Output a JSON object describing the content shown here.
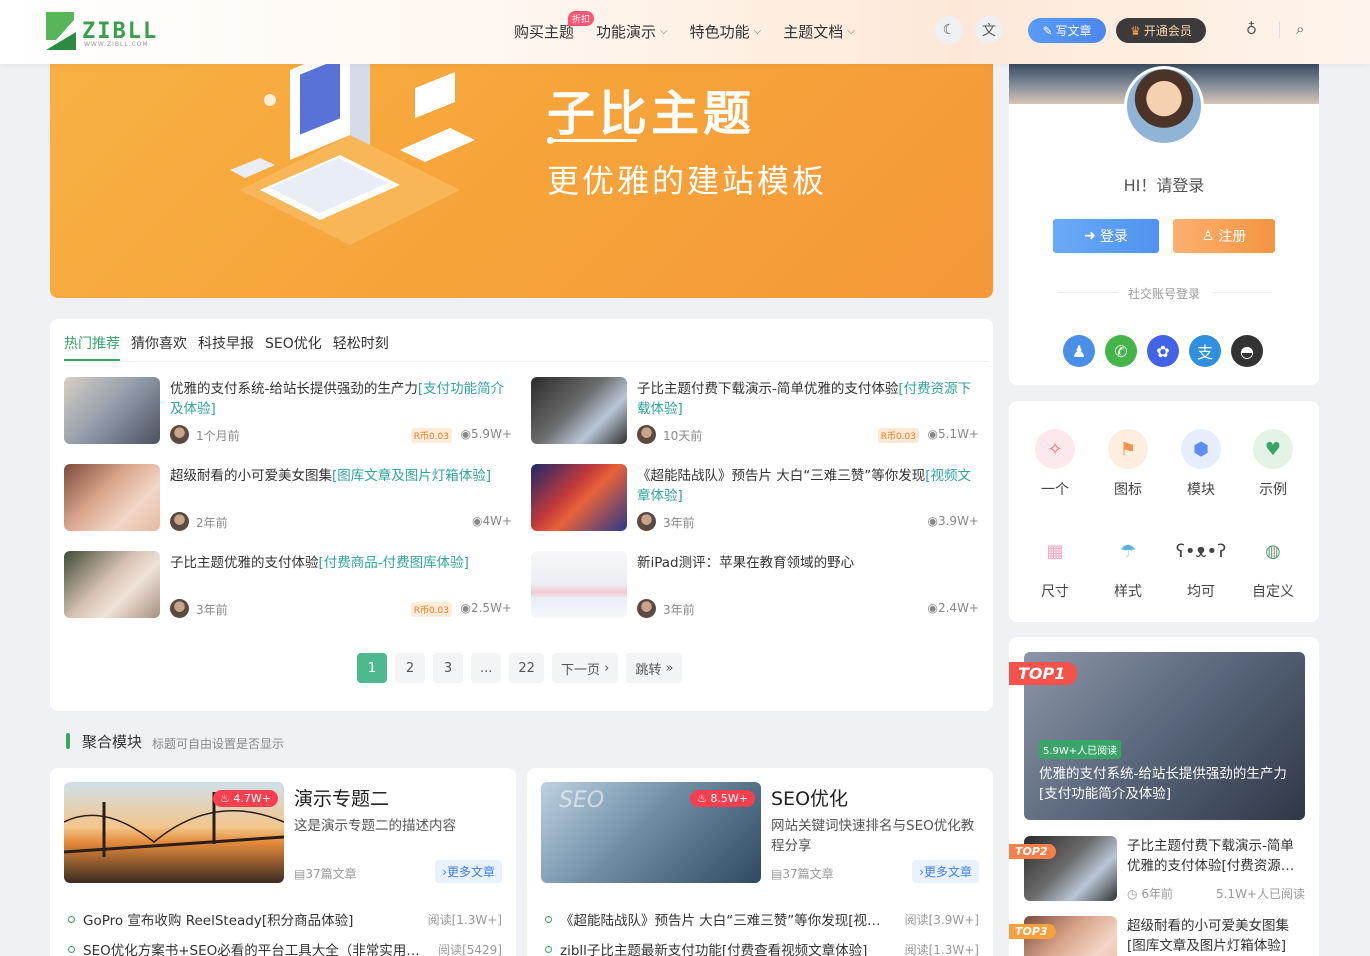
{
  "header": {
    "logo_text": "ZIBLL",
    "logo_sub": "WWW.ZIBLL.COM",
    "nav": [
      {
        "label": "购买主题",
        "badge": "折扣",
        "chevron": false
      },
      {
        "label": "功能演示",
        "chevron": true
      },
      {
        "label": "特色功能",
        "chevron": true
      },
      {
        "label": "主题文档",
        "chevron": true
      }
    ],
    "write_label": "写文章",
    "vip_label": "开通会员"
  },
  "banner": {
    "title": "子比主题",
    "subtitle": "更优雅的建站模板"
  },
  "posts": {
    "tabs": [
      "热门推荐",
      "猜你喜欢",
      "科技早报",
      "SEO优化",
      "轻松时刻"
    ],
    "items": [
      {
        "title": "优雅的支付系统-给站长提供强劲的生产力",
        "tag": "[支付功能简介及体验]",
        "time": "1个月前",
        "price": "R币0.03",
        "views": "5.9W+"
      },
      {
        "title": "子比主题付费下载演示-简单优雅的支付体验",
        "tag": "[付费资源下载体验]",
        "time": "10天前",
        "price": "R币0.03",
        "views": "5.1W+"
      },
      {
        "title": "超级耐看的小可爱美女图集",
        "tag": "[图库文章及图片灯箱体验]",
        "time": "2年前",
        "price": "",
        "views": "4W+"
      },
      {
        "title": "《超能陆战队》预告片 大白“三难三赞”等你发现",
        "tag": "[视频文章体验]",
        "time": "3年前",
        "price": "",
        "views": "3.9W+"
      },
      {
        "title": "子比主题优雅的支付体验",
        "tag": "[付费商品-付费图库体验]",
        "time": "3年前",
        "price": "R币0.03",
        "views": "2.5W+"
      },
      {
        "title": "新iPad测评：苹果在教育领域的野心",
        "tag": "",
        "time": "3年前",
        "price": "",
        "views": "2.4W+"
      }
    ],
    "pager": {
      "pages": [
        "1",
        "2",
        "3",
        "...",
        "22"
      ],
      "next": "下一页",
      "jump": "跳转"
    }
  },
  "section": {
    "title": "聚合模块",
    "subtitle": "标题可自由设置是否显示"
  },
  "topics": [
    {
      "hot": "4.7W+",
      "name": "演示专题二",
      "desc": "这是演示专题二的描述内容",
      "count": "37篇文章",
      "more": "›更多文章",
      "list": [
        {
          "title": "GoPro 宣布收购 ReelSteady[积分商品体验]",
          "reads": "阅读[1.3W+]"
        },
        {
          "title": "SEO优化方案书+SEO必看的平台工具大全（非常实用…",
          "reads": "阅读[5429]"
        }
      ]
    },
    {
      "hot": "8.5W+",
      "name": "SEO优化",
      "desc": "网站关键词快速排名与SEO优化教程分享",
      "count": "37篇文章",
      "more": "›更多文章",
      "list": [
        {
          "title": "《超能陆战队》预告片 大白“三难三赞”等你发现[视…",
          "reads": "阅读[3.9W+]"
        },
        {
          "title": "zibll子比主题最新支付功能[付费查看视频文章体验]",
          "reads": "阅读[1.3W+]"
        }
      ]
    }
  ],
  "sidebar": {
    "greeting": "HI！请登录",
    "login": "登录",
    "register": "注册",
    "social_label": "社交账号登录",
    "grid": [
      {
        "label": "一个",
        "icon": "wand-icon",
        "color": "#f56d7a"
      },
      {
        "label": "图标",
        "icon": "flag-icon",
        "color": "#f7904a"
      },
      {
        "label": "模块",
        "icon": "cube-icon",
        "color": "#5b8ff0"
      },
      {
        "label": "示例",
        "icon": "heart-icon",
        "color": "#3aa568"
      },
      {
        "label": "尺寸",
        "icon": "cake-icon",
        "color": "#f4a7c0"
      },
      {
        "label": "样式",
        "icon": "beach-icon",
        "color": "#58b7d8"
      },
      {
        "label": "均可",
        "icon": "bear-icon",
        "color": "#444444"
      },
      {
        "label": "自定义",
        "icon": "globe-icon",
        "color": "#5a9a70"
      }
    ],
    "ranking": [
      {
        "tag": "TOP1",
        "readers": "5.9W+人已阅读",
        "title": "优雅的支付系统-给站长提供强劲的生产力[支付功能简介及体验]"
      },
      {
        "tag": "TOP2",
        "title": "子比主题付费下载演示-简单优雅的支付体验[付费资源…",
        "time": "6年前",
        "reads": "5.1W+人已阅读"
      },
      {
        "tag": "TOP3",
        "title": "超级耐看的小可爱美女图集[图库文章及图片灯箱体验]"
      }
    ]
  }
}
